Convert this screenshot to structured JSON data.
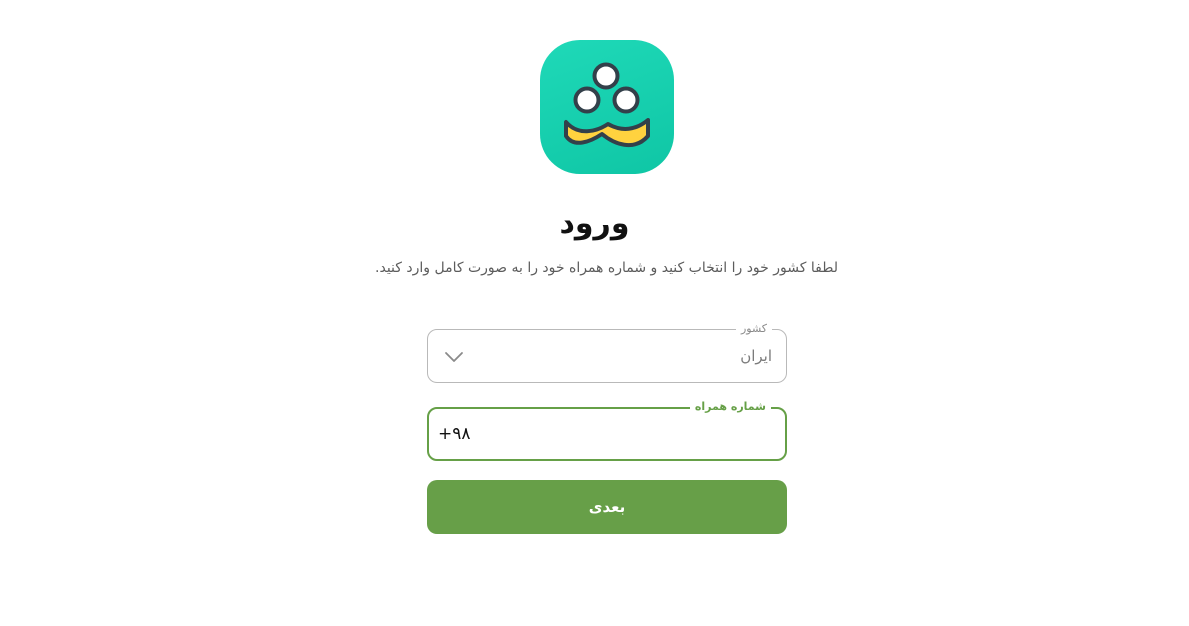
{
  "logo": {
    "icon": "balls-and-mustache-logo-icon",
    "background_color": "#12cfae",
    "accent_color": "#ffd23f",
    "outline_color": "#33404a"
  },
  "header": {
    "title": "ورود",
    "subtitle": "لطفا کشور خود را انتخاب کنید و شماره همراه خود را به صورت کامل وارد کنید."
  },
  "form": {
    "country": {
      "label": "کشور",
      "value": "ایران",
      "icon": "chevron-down-icon"
    },
    "phone": {
      "label": "شماره همراه",
      "value": "+۹۸"
    },
    "next_button": {
      "label": "بعدی",
      "color": "#679f48"
    }
  }
}
